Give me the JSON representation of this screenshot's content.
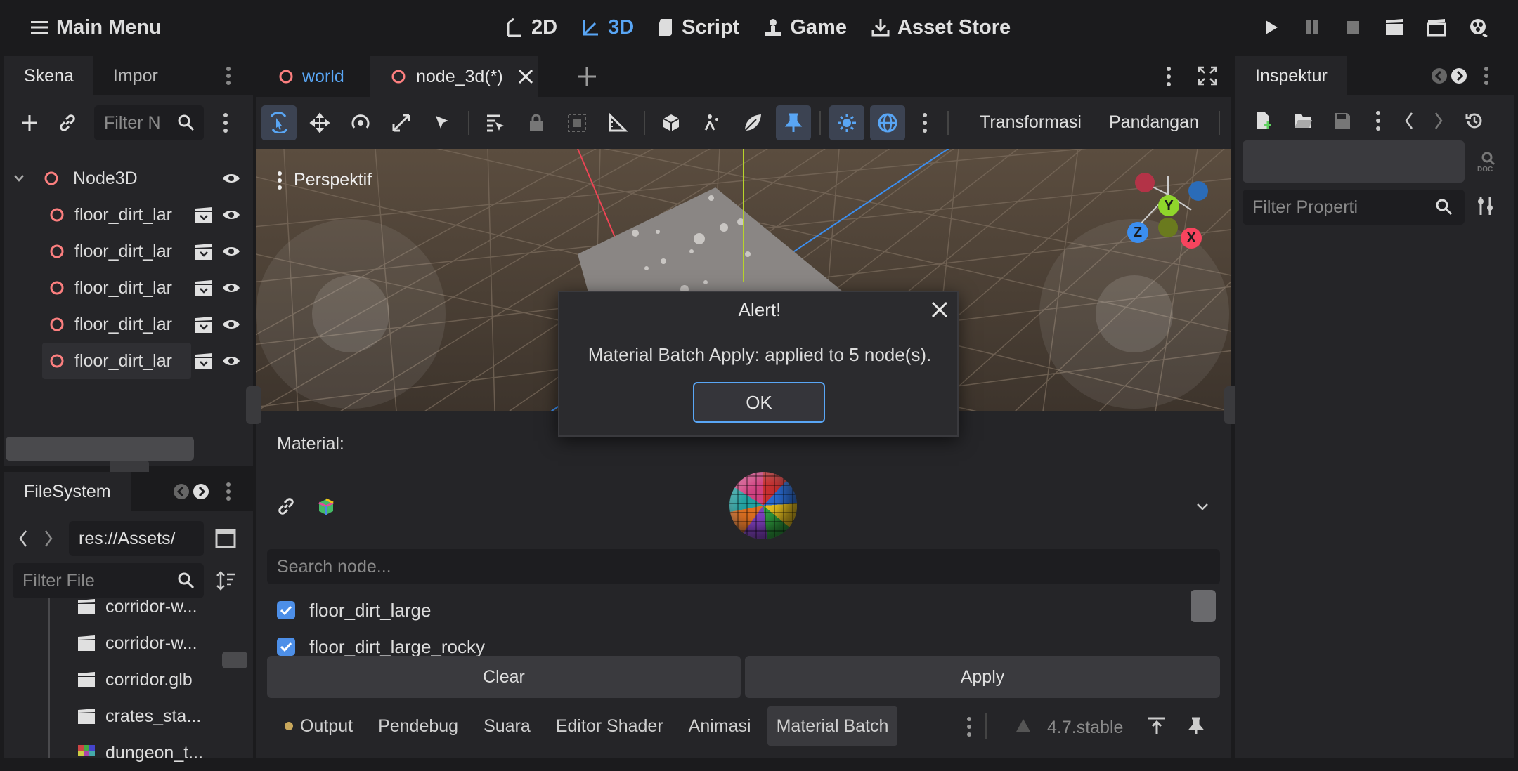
{
  "topbar": {
    "main_menu": "Main Menu",
    "tabs": [
      {
        "label": "2D",
        "icon": "2d-icon"
      },
      {
        "label": "3D",
        "icon": "3d-icon",
        "active": true
      },
      {
        "label": "Script",
        "icon": "script-icon"
      },
      {
        "label": "Game",
        "icon": "game-icon"
      },
      {
        "label": "Asset Store",
        "icon": "asset-store-icon"
      }
    ]
  },
  "scene_dock": {
    "tabs": [
      "Skena",
      "Impor"
    ],
    "filter_placeholder": "Filter N",
    "root": "Node3D",
    "children": [
      "floor_dirt_lar",
      "floor_dirt_lar",
      "floor_dirt_lar",
      "floor_dirt_lar",
      "floor_dirt_lar"
    ]
  },
  "filesystem": {
    "title": "FileSystem",
    "path": "res://Assets/",
    "filter_placeholder": "Filter File",
    "files": [
      "corridor-w...",
      "corridor-w...",
      "corridor.glb",
      "crates_sta...",
      "dungeon_t..."
    ]
  },
  "editor_tabs": {
    "tabs": [
      "world",
      "node_3d(*)"
    ]
  },
  "toolbar": {
    "transform": "Transformasi",
    "view": "Pandangan"
  },
  "viewport": {
    "label": "Perspektif",
    "gizmo": {
      "y": "Y",
      "z": "Z",
      "x": "X"
    }
  },
  "alert": {
    "title": "Alert!",
    "message": "Material Batch Apply: applied to 5 node(s).",
    "ok": "OK"
  },
  "material_panel": {
    "label": "Material:",
    "search_placeholder": "Search node...",
    "nodes": [
      {
        "name": "floor_dirt_large",
        "checked": true
      },
      {
        "name": "floor_dirt_large_rocky",
        "checked": true
      }
    ],
    "clear": "Clear",
    "apply": "Apply"
  },
  "bottom_tabs": [
    "Output",
    "Pendebug",
    "Suara",
    "Editor Shader",
    "Animasi",
    "Material Batch"
  ],
  "version": "4.7.stable",
  "inspector": {
    "tab": "Inspektur",
    "filter_placeholder": "Filter Properti"
  },
  "colors": {
    "accent": "#59a6f5",
    "node_icon": "#fc7f7f",
    "axis_x": "#f7445e",
    "axis_y": "#8fd62b",
    "axis_z": "#3b8ef0"
  }
}
